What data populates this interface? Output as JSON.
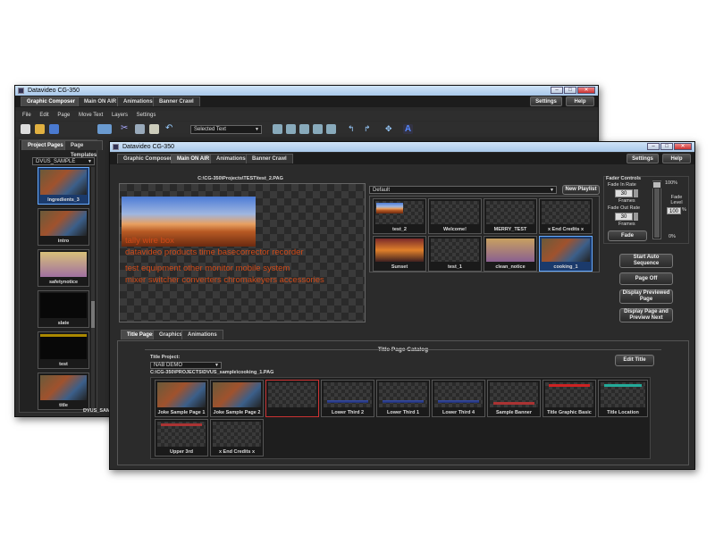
{
  "back_window": {
    "title": "Datavideo CG-350",
    "tabs": [
      "Graphic Composer",
      "Main ON AIR",
      "Animations",
      "Banner Crawl"
    ],
    "settings": "Settings",
    "help": "Help",
    "menu": [
      "File",
      "Edit",
      "Page",
      "Move Text",
      "Layers",
      "Settings"
    ],
    "selected_text": "Selected Text",
    "sidebar_tabs": [
      "Project Pages",
      "Page Templates"
    ],
    "project_select": "DVUS_SAMPLE",
    "pages": [
      "Ingredients_3",
      "intro",
      "safetynotice",
      "slate",
      "test",
      "title"
    ],
    "status": "DVUS_SAMP"
  },
  "front_window": {
    "title": "Datavideo CG-350",
    "tabs": [
      "Graphic Composer",
      "Main ON AIR",
      "Animations",
      "Banner Crawl"
    ],
    "settings": "Settings",
    "help": "Help",
    "preview_path": "C:\\CG-350\\Projects\\TEST\\test_2.PAG",
    "preview_lines": [
      "tally wire box",
      "datavideo products time basecorrector recorder",
      "test equipment other monitor mobile system",
      "mixer switcher converters chromakeyers accessories"
    ],
    "playlist_select": "Default",
    "new_playlist": "New Playlist",
    "playlist_items": [
      "test_2",
      "Welcome!",
      "MERRY_TEST",
      "x End Credits x",
      "Sunset",
      "test_1",
      "clean_notice",
      "cooking_1"
    ],
    "fader": {
      "title": "Fader Controls",
      "fade_in_rate": "Fade In Rate",
      "fade_in_value": "30",
      "frames1": "Frames",
      "fade_out_rate": "Fade Out Rate",
      "fade_out_value": "30",
      "frames2": "Frames",
      "fade_btn": "Fade",
      "pct_top": "100%",
      "pct_bottom": "0%",
      "fade_level_label": "Fade Level",
      "fade_level_value": "100",
      "pct_sign": "%",
      "level": 1.0
    },
    "actions": [
      "Start Auto Sequence",
      "Page Off",
      "Display Previewed Page",
      "Display Page and Preview Next"
    ],
    "bottom_tabs": [
      "Title Pages",
      "Graphics",
      "Animations"
    ],
    "catalog": {
      "title": "Title Page Catalog",
      "project_label": "Title Project:",
      "project_value": "NAB DEMO",
      "path": "C:\\CG-350\\PROJECTS\\DVUS_sample\\cooking_1.PAG",
      "edit_title": "Edit Title",
      "items": [
        "Joke Sample Page 1",
        "Joke Sample Page 2",
        "",
        "Lower Third 2",
        "Lower Third 1",
        "Lower Third 4",
        "Sample Banner",
        "Title Graphic Basic",
        "Title Location",
        "Upper 3rd",
        "x End Credits x"
      ]
    }
  }
}
